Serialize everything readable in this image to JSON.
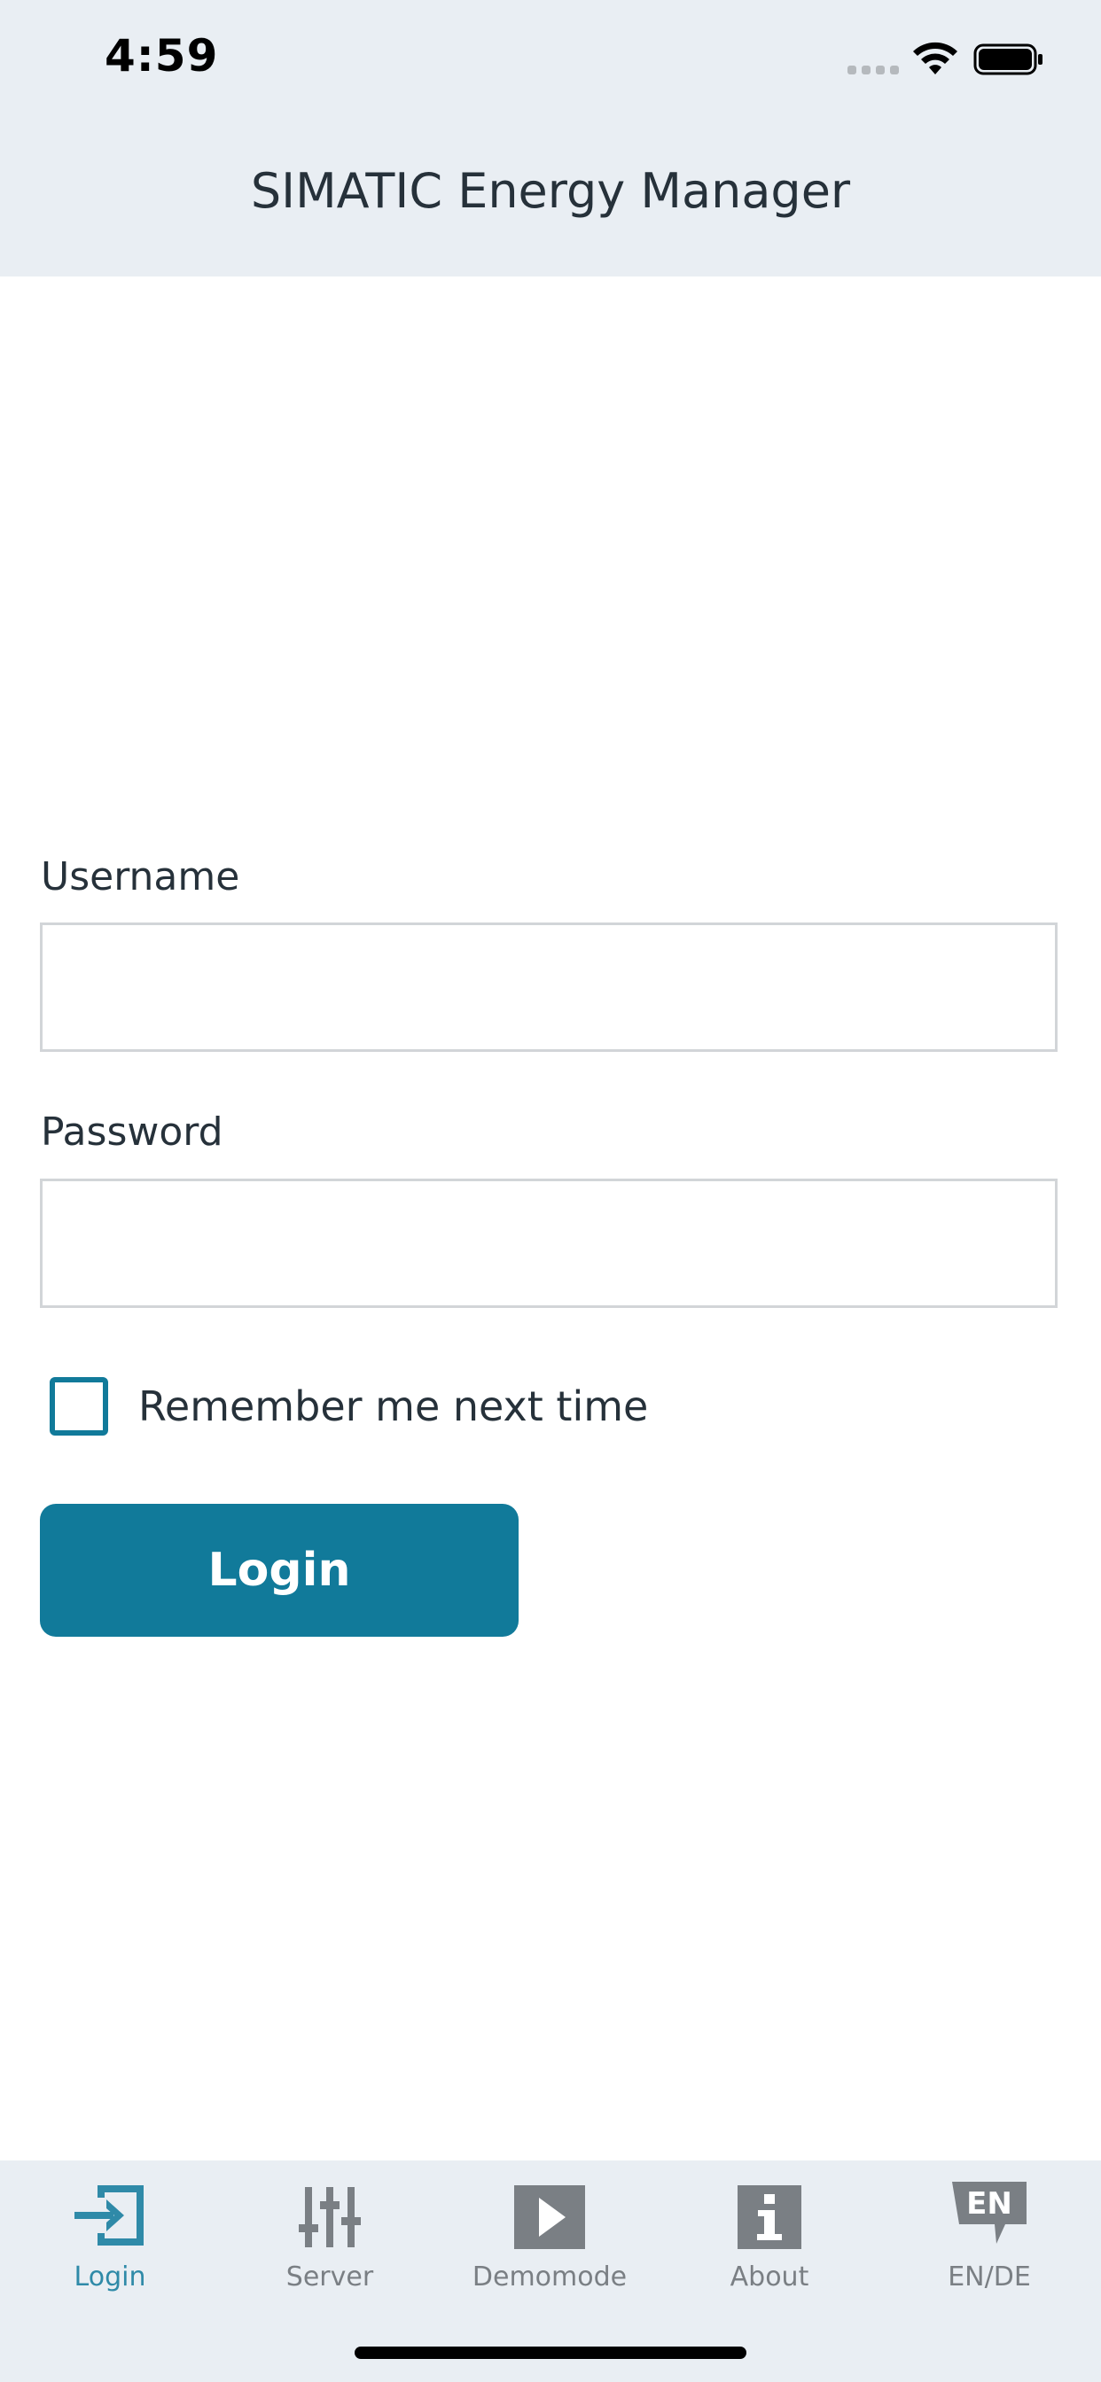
{
  "status_bar": {
    "time": "4:59"
  },
  "header": {
    "title": "SIMATIC Energy Manager"
  },
  "form": {
    "username_label": "Username",
    "username_value": "",
    "password_label": "Password",
    "password_value": "",
    "remember_label": "Remember me next time",
    "remember_checked": false,
    "login_label": "Login"
  },
  "tabbar": {
    "items": [
      {
        "label": "Login",
        "icon": "login-icon",
        "active": true
      },
      {
        "label": "Server",
        "icon": "sliders-icon",
        "active": false
      },
      {
        "label": "Demomode",
        "icon": "play-icon",
        "active": false
      },
      {
        "label": "About",
        "icon": "info-icon",
        "active": false
      },
      {
        "label": "EN/DE",
        "icon": "language-icon",
        "active": false
      }
    ]
  },
  "colors": {
    "accent": "#117a9a",
    "bar_background": "#e9eef3",
    "inactive_icon": "#7a7f84"
  }
}
